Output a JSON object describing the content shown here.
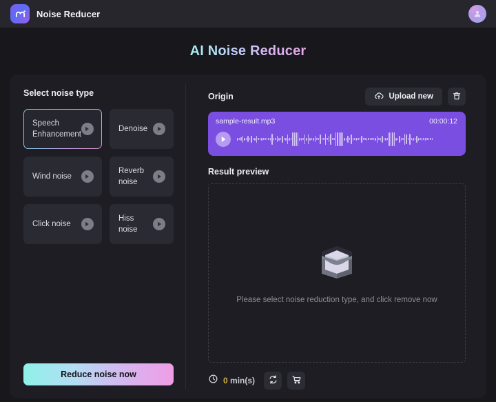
{
  "header": {
    "brand_name": "Noise Reducer",
    "logo_icon": "m-logo-icon",
    "avatar_icon": "user-avatar-icon"
  },
  "page": {
    "title": "AI Noise Reducer"
  },
  "left_panel": {
    "section_label": "Select noise type",
    "noise_types": [
      {
        "label": "Speech Enhancement",
        "selected": true,
        "play_icon": "play-icon"
      },
      {
        "label": "Denoise",
        "selected": false,
        "play_icon": "play-icon"
      },
      {
        "label": "Wind noise",
        "selected": false,
        "play_icon": "play-icon"
      },
      {
        "label": "Reverb noise",
        "selected": false,
        "play_icon": "play-icon"
      },
      {
        "label": "Click noise",
        "selected": false,
        "play_icon": "play-icon"
      },
      {
        "label": "Hiss noise",
        "selected": false,
        "play_icon": "play-icon"
      }
    ],
    "reduce_button_label": "Reduce noise now"
  },
  "right_panel": {
    "origin_label": "Origin",
    "upload_button_label": "Upload new",
    "upload_icon": "cloud-upload-icon",
    "delete_icon": "trash-icon",
    "player": {
      "file_name": "sample-result.mp3",
      "duration": "00:00:12",
      "play_icon": "play-icon",
      "track_color": "#7a4ee0"
    },
    "result_label": "Result preview",
    "empty_state": {
      "icon": "empty-box-icon",
      "message": "Please select noise reduction type, and click remove now"
    },
    "bottom_bar": {
      "clock_icon": "clock-icon",
      "minutes_value": "0",
      "minutes_unit": " min(s)",
      "refresh_icon": "refresh-icon",
      "cart_icon": "shopping-cart-icon"
    }
  },
  "colors": {
    "page_bg": "#17171c",
    "header_bg": "#26262c",
    "card_bg": "#1d1d23",
    "tile_bg": "#2a2a32",
    "accent_purple": "#7a4ee0",
    "gradient_start": "#8ef2e8",
    "gradient_end": "#ef9de6",
    "minutes_accent": "#cbb24a"
  }
}
